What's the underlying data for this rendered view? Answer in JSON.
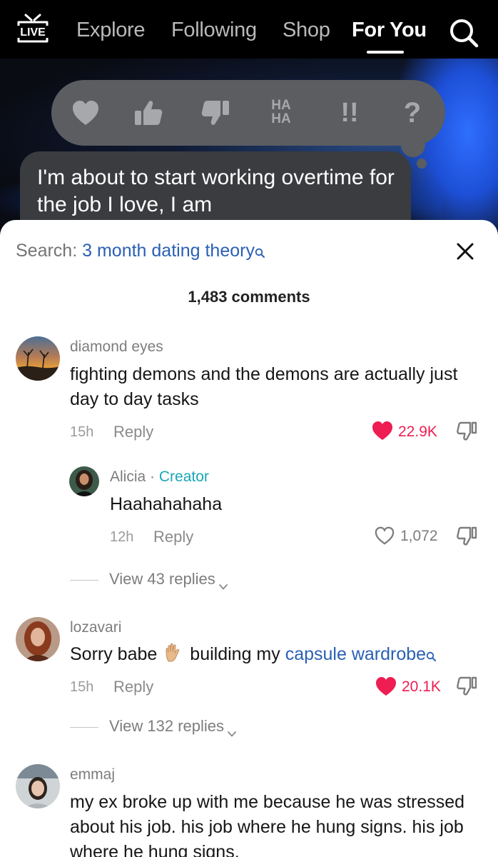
{
  "nav": {
    "live_label": "LIVE",
    "tabs": [
      {
        "label": "Explore"
      },
      {
        "label": "Following"
      },
      {
        "label": "Shop"
      },
      {
        "label": "For You"
      }
    ]
  },
  "video": {
    "reactions": {
      "haha_top": "HA",
      "haha_bottom": "HA",
      "exclaim": "!!",
      "question": "?"
    },
    "message_text": "I'm about to start working overtime for the job I love, I am"
  },
  "comments_sheet": {
    "search_prefix": "Search:",
    "search_query": "3 month dating theory",
    "count_label": "1,483 comments",
    "comments": [
      {
        "username": "diamond eyes",
        "text": "fighting demons and the demons are actually just day to day tasks",
        "time": "15h",
        "reply_label": "Reply",
        "likes": "22.9K",
        "liked": true
      },
      {
        "username": "Alicia",
        "separator": "·",
        "badge": "Creator",
        "text": "Haahahahaha",
        "time": "12h",
        "reply_label": "Reply",
        "likes": "1,072",
        "liked": false
      },
      {
        "username": "lozavari",
        "text_before": "Sorry babe",
        "text_middle": "building my",
        "text_link": "capsule wardrobe",
        "time": "15h",
        "reply_label": "Reply",
        "likes": "20.1K",
        "liked": true
      },
      {
        "username": "emmaj",
        "text": "my ex broke up with me because he was stressed about his job. his job where he hung signs. his job where he hung signs."
      }
    ],
    "view_replies_1": "View 43 replies",
    "view_replies_2": "View 132 replies"
  },
  "colors": {
    "like_red": "#ee1d52",
    "link_blue": "#2a5fb5",
    "creator_teal": "#1aa6b7"
  }
}
